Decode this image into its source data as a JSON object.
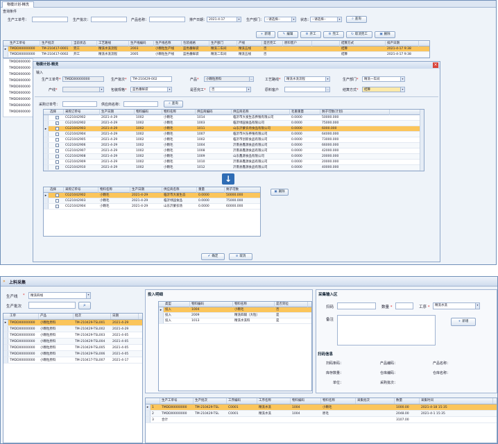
{
  "top": {
    "tab_title": "物模计划-精洗",
    "query_label": "查询条件",
    "f1_label": "生产工单号：",
    "f2_label": "生产批次：",
    "f3_label": "产品名称：",
    "f4_label": "排产日期：",
    "f4_value": "2021-4-17",
    "f5_label": "生产部门：",
    "f5_value": "--请选择--",
    "f6_label": "状态：",
    "f6_value": "--请选择--",
    "query_btn": "查询",
    "toolbar": [
      "新增",
      "编辑",
      "开工",
      "完工",
      "取消完工",
      "删除"
    ],
    "grid_headers": [
      "生产工单号",
      "生产批次",
      "当前状态",
      "工艺路线",
      "生产线编码",
      "生产线名称",
      "包装规格",
      "生产部门",
      "产线",
      "是否完工",
      "原料客户",
      "",
      "结算方式",
      "排产日期"
    ],
    "grid_rows": [
      [
        "TMDD00000000",
        "TM-210417-0001",
        "完工",
        "精洗水洗流程",
        "2003",
        "小颗粒生产线",
        "蓝色番鲜袋",
        "精洗二车间",
        "精洗五线",
        "否",
        "",
        "",
        "结算",
        "2021-4-17 9:38"
      ],
      [
        "TMDD00000000",
        "TM-210417-0002",
        "开工",
        "精洗水洗流程",
        "2005",
        "小颗粒生产线",
        "蓝色番鲜袋",
        "精洗二车间",
        "精洗五线",
        "否",
        "",
        "",
        "结算",
        "2021-4-17 9:38"
      ]
    ],
    "left_ids": [
      "TMDD000000",
      "TMDD000000",
      "TMDD000000",
      "TMDD000000",
      "TMDD000000",
      "TMDD000000",
      "TMDD000000",
      "TMDD000000",
      "TMDD000000"
    ],
    "dialog": {
      "title": "物模计划-精洗",
      "subtitle": "输入",
      "d1_label": "生产工单号",
      "d1_value": "TMDD00000000",
      "d2_label": "生产批次",
      "d2_value": "TM-210429-002",
      "d3_label": "产品",
      "d3_value": "小颗粒原料",
      "d4_label": "工艺路线",
      "d4_value": "精洗水洗流程",
      "d5_label": "生产部门",
      "d5_value": "精洗一车间",
      "d6_label": "产线",
      "d6_value": "",
      "d7_label": "包装规格",
      "d7_value": "蓝色番鲜袋",
      "d8_label": "是否完工",
      "d8_value": "否",
      "d9_label": "原料客户",
      "d9_value": "",
      "d10_label": "结算方式",
      "d10_value": "结算",
      "s1_label": "采购订单号：",
      "s2_label": "供应商名称：",
      "search_btn": "查询",
      "upper_headers": [
        "选择",
        "采购订单号",
        "生产日期",
        "物料编码",
        "物料名称",
        "供应商编码",
        "供应商名称",
        "毛重重量",
        "剩子可数(计划)"
      ],
      "upper_rows": [
        [
          "1",
          "CG21042902",
          "2021-4-29",
          "1002",
          "小颗毛",
          "1014",
          "临沂市大发生态养殖有限公司",
          "0.0000",
          "50000.000"
        ],
        [
          "1",
          "CG21042902",
          "2021-4-29",
          "1002",
          "小颗毛",
          "1003",
          "临沂绿园食品有限公司",
          "0.0000",
          "75000.000"
        ],
        [
          "0",
          "CG21042903",
          "2021-4-29",
          "1002",
          "小颗毛",
          "1011",
          "山东沂蒙农场食品有限公司",
          "0.0000",
          "6000.000"
        ],
        [
          "0",
          "CG21042904",
          "2021-4-29",
          "1002",
          "小颗毛",
          "1007",
          "临沂市兴东养殖有限公司",
          "0.0000",
          "64000.000"
        ],
        [
          "0",
          "CG21042905",
          "2021-4-29",
          "1002",
          "小颗毛",
          "1002",
          "临沂市创新食品有限公司",
          "0.0000",
          "73000.000"
        ],
        [
          "0",
          "CG21042906",
          "2021-4-29",
          "1002",
          "小颗毛",
          "1004",
          "沂南县鑫源食品有限公司",
          "0.0000",
          "66000.000"
        ],
        [
          "0",
          "CG21042907",
          "2021-4-29",
          "1002",
          "小颗毛",
          "1008",
          "沂南县鑫源食品有限公司",
          "0.0000",
          "42000.000"
        ],
        [
          "0",
          "CG21042908",
          "2021-4-29",
          "1002",
          "小颗毛",
          "1009",
          "山东鑫源食品有限公司",
          "0.0000",
          "20000.000"
        ],
        [
          "0",
          "CG21042909",
          "2021-4-29",
          "1002",
          "小颗毛",
          "1010",
          "沂南县鑫源食品有限公司",
          "0.0000",
          "20000.000"
        ],
        [
          "0",
          "CG21042910",
          "2021-4-29",
          "1002",
          "小颗毛",
          "1012",
          "沂南县鑫源食品有限公司",
          "0.0000",
          "40000.000"
        ]
      ],
      "lower_headers": [
        "选择",
        "采购订单号",
        "物料名称",
        "生产日期",
        "供应商名称",
        "重量",
        "剩子可数"
      ],
      "lower_rows": [
        [
          "0",
          "CG21042902",
          "小颗毛",
          "2021-4-29",
          "临沂市大发生态",
          "0.0000",
          "50000.000"
        ],
        [
          "0",
          "CG21042903",
          "小颗毛",
          "2021-4-29",
          "临沂绿园食品",
          "0.0000",
          "75000.000"
        ],
        [
          "0",
          "CG21042904",
          "小颗毛",
          "2021-4-29",
          "山东沂蒙农场",
          "0.0000",
          "60000.000"
        ]
      ],
      "remove_btn": "删除",
      "ok_btn": "确定",
      "cancel_btn": "取消"
    }
  },
  "bottom": {
    "tab_title": "上料采集",
    "line_label": "生产线",
    "line_value": "精洗四线",
    "batch_label": "生产批次",
    "left_headers": [
      "工单",
      "产品",
      "批次",
      "日期"
    ],
    "left_rows": [
      [
        "TMDD00000000",
        "小颗粒原料",
        "TM-210429-TSL001",
        "2021-4-29"
      ],
      [
        "TMDD00000000",
        "小颗粒原料",
        "TM-210429-TSL002",
        "2021-4-29"
      ],
      [
        "TMDD00000000",
        "小颗粒原料",
        "TM-210429-TSL003",
        "2021-4-05"
      ],
      [
        "TMDD00000000",
        "小颗粒原料",
        "TM-210429-TSL004",
        "2021-4-05"
      ],
      [
        "TMDD00000000",
        "小颗粒原料",
        "TM-210429-TSL005",
        "2021-4-05"
      ],
      [
        "TMDD00000000",
        "小颗粒原料",
        "TM-210429-TSL006",
        "2021-4-05"
      ],
      [
        "TMDD00000000",
        "小颗粒原料",
        "TM-210417-TSL007",
        "2021-4-17"
      ]
    ],
    "input_title": "投入明细",
    "input_headers": [
      "类型",
      "物料编码",
      "物料名称",
      "是否到位"
    ],
    "input_rows": [
      [
        "投入",
        "1004",
        "小颗毛",
        "否"
      ],
      [
        "投入",
        "2009",
        "精洗四辅（大粒）",
        "是"
      ],
      [
        "投入",
        "1013",
        "精洗水洗料",
        "是"
      ]
    ],
    "collect_title": "采集输入区",
    "scan_label": "扫码",
    "qty_label": "数量",
    "proc_label": "工序",
    "proc_value": "精洗水洗",
    "remark_label": "备注",
    "add_btn": "新增",
    "scan_info_title": "扫码信息",
    "info": [
      "扫码条码：",
      "产品编码：",
      "产品名称：",
      "库存数量：",
      "仓库编码：",
      "仓库名称：",
      "单位：",
      "采购批次："
    ],
    "res_headers": [
      "",
      "生产工单号",
      "生产批次",
      "工序编码",
      "工序名称",
      "物料编码",
      "物料名称",
      "采集批次",
      "数量",
      "采集时间"
    ],
    "res_rows": [
      [
        "1",
        "TMDD00000000",
        "TM-210429-TSL",
        "C0001",
        "精洗水洗",
        "1004",
        "小颗毛",
        "",
        "1000.00",
        "2021-4-18 15:35"
      ],
      [
        "2",
        "TMDD00000000",
        "TM-210429-TSL",
        "C0001",
        "精洗水洗",
        "1004",
        "原毛",
        "",
        "2048.00",
        "2021-4-1 15:35"
      ],
      [
        "3",
        "合计",
        "",
        "",
        "",
        "",
        "",
        "",
        "3107.00",
        ""
      ]
    ]
  }
}
